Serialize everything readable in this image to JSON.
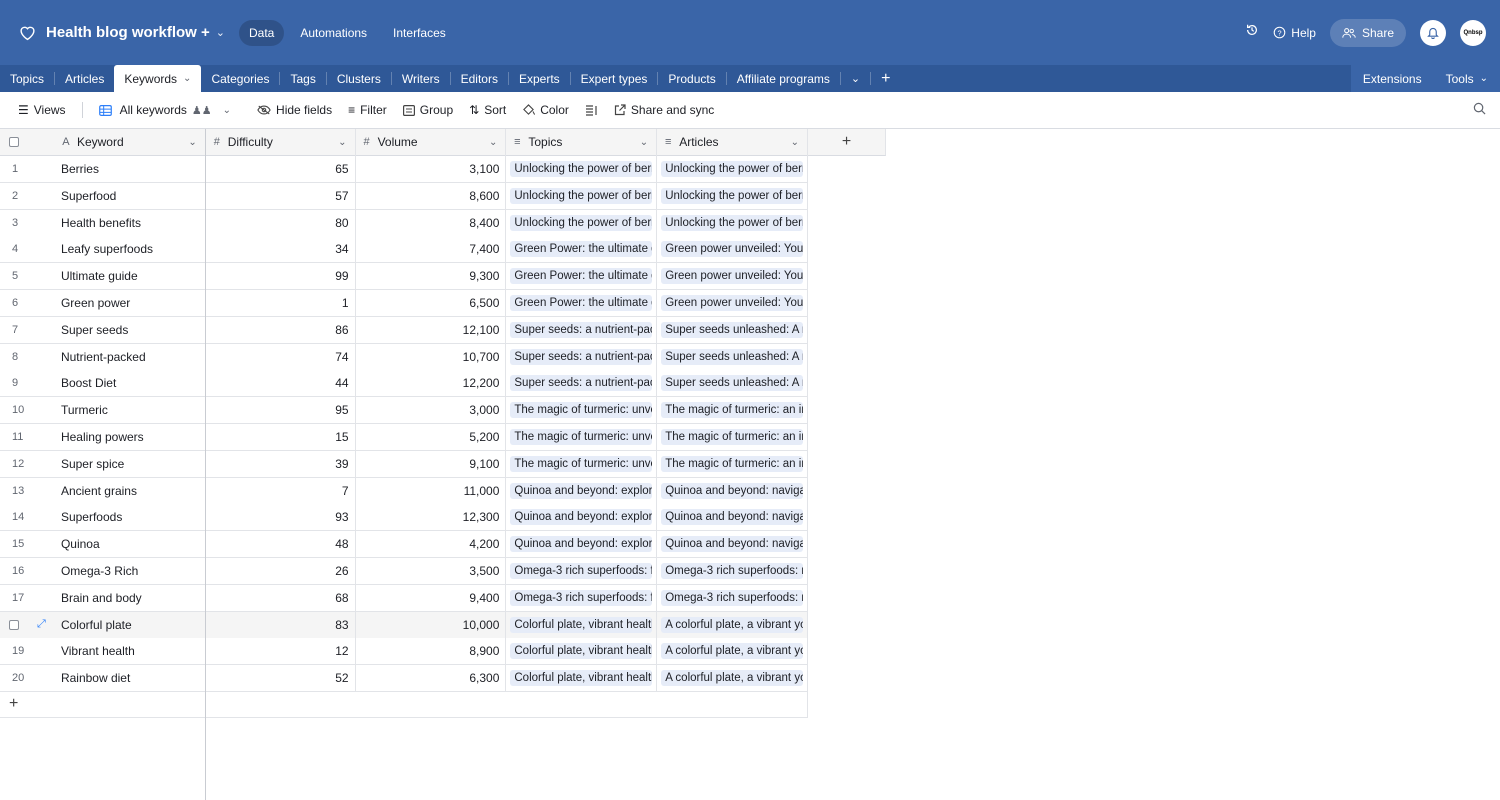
{
  "app": {
    "base_title": "Health blog workflow +",
    "nav": [
      {
        "label": "Data",
        "active": true
      },
      {
        "label": "Automations",
        "active": false
      },
      {
        "label": "Interfaces",
        "active": false
      }
    ],
    "help_label": "Help",
    "share_label": "Share",
    "avatar_text": "Qnbsp",
    "brand_color": "#3a65a8"
  },
  "tables": {
    "items": [
      "Topics",
      "Articles",
      "Keywords",
      "Categories",
      "Tags",
      "Clusters",
      "Writers",
      "Editors",
      "Experts",
      "Expert types",
      "Products",
      "Affiliate programs"
    ],
    "active": "Keywords",
    "extensions_label": "Extensions",
    "tools_label": "Tools"
  },
  "viewbar": {
    "views_label": "Views",
    "view_name": "All keywords",
    "hide_fields_label": "Hide fields",
    "filter_label": "Filter",
    "group_label": "Group",
    "sort_label": "Sort",
    "color_label": "Color",
    "share_sync_label": "Share and sync"
  },
  "columns": [
    {
      "label": "Keyword",
      "icon": "text-icon"
    },
    {
      "label": "Difficulty",
      "icon": "number-icon"
    },
    {
      "label": "Volume",
      "icon": "number-icon"
    },
    {
      "label": "Topics",
      "icon": "link-icon"
    },
    {
      "label": "Articles",
      "icon": "link-icon"
    }
  ],
  "rows": [
    {
      "n": "1",
      "keyword": "Berries",
      "difficulty": "65",
      "volume": "3,100",
      "topic": "Unlocking the power of berr",
      "article": "Unlocking the power of berr"
    },
    {
      "n": "2",
      "keyword": "Superfood",
      "difficulty": "57",
      "volume": "8,600",
      "topic": "Unlocking the power of berr",
      "article": "Unlocking the power of berr"
    },
    {
      "n": "3",
      "keyword": "Health benefits",
      "difficulty": "80",
      "volume": "8,400",
      "topic": "Unlocking the power of berr",
      "article": "Unlocking the power of berr"
    },
    {
      "n": "4",
      "keyword": "Leafy superfoods",
      "difficulty": "34",
      "volume": "7,400",
      "topic": "Green Power: the ultimate g",
      "article": "Green power unveiled: Your"
    },
    {
      "n": "5",
      "keyword": "Ultimate guide",
      "difficulty": "99",
      "volume": "9,300",
      "topic": "Green Power: the ultimate g",
      "article": "Green power unveiled: Your"
    },
    {
      "n": "6",
      "keyword": "Green power",
      "difficulty": "1",
      "volume": "6,500",
      "topic": "Green Power: the ultimate g",
      "article": "Green power unveiled: Your"
    },
    {
      "n": "7",
      "keyword": "Super seeds",
      "difficulty": "86",
      "volume": "12,100",
      "topic": "Super seeds: a nutrient-pac",
      "article": "Super seeds unleashed: A n"
    },
    {
      "n": "8",
      "keyword": "Nutrient-packed",
      "difficulty": "74",
      "volume": "10,700",
      "topic": "Super seeds: a nutrient-pac",
      "article": "Super seeds unleashed: A n"
    },
    {
      "n": "9",
      "keyword": "Boost Diet",
      "difficulty": "44",
      "volume": "12,200",
      "topic": "Super seeds: a nutrient-pac",
      "article": "Super seeds unleashed: A n"
    },
    {
      "n": "10",
      "keyword": "Turmeric",
      "difficulty": "95",
      "volume": "3,000",
      "topic": "The magic of turmeric: unve",
      "article": "The magic of turmeric: an ir"
    },
    {
      "n": "11",
      "keyword": "Healing powers",
      "difficulty": "15",
      "volume": "5,200",
      "topic": "The magic of turmeric: unve",
      "article": "The magic of turmeric: an ir"
    },
    {
      "n": "12",
      "keyword": "Super spice",
      "difficulty": "39",
      "volume": "9,100",
      "topic": "The magic of turmeric: unve",
      "article": "The magic of turmeric: an ir"
    },
    {
      "n": "13",
      "keyword": "Ancient grains",
      "difficulty": "7",
      "volume": "11,000",
      "topic": "Quinoa and beyond: explori",
      "article": "Quinoa and beyond: navigat"
    },
    {
      "n": "14",
      "keyword": "Superfoods",
      "difficulty": "93",
      "volume": "12,300",
      "topic": "Quinoa and beyond: explori",
      "article": "Quinoa and beyond: navigat"
    },
    {
      "n": "15",
      "keyword": "Quinoa",
      "difficulty": "48",
      "volume": "4,200",
      "topic": "Quinoa and beyond: explori",
      "article": "Quinoa and beyond: navigat"
    },
    {
      "n": "16",
      "keyword": "Omega-3 Rich",
      "difficulty": "26",
      "volume": "3,500",
      "topic": "Omega-3 rich superfoods: f",
      "article": "Omega-3 rich superfoods: r"
    },
    {
      "n": "17",
      "keyword": "Brain and body",
      "difficulty": "68",
      "volume": "9,400",
      "topic": "Omega-3 rich superfoods: f",
      "article": "Omega-3 rich superfoods: r"
    },
    {
      "n": "",
      "keyword": "Colorful plate",
      "difficulty": "83",
      "volume": "10,000",
      "topic": "Colorful plate, vibrant healtl",
      "article": "A colorful plate, a vibrant yo",
      "hover": true
    },
    {
      "n": "19",
      "keyword": "Vibrant health",
      "difficulty": "12",
      "volume": "8,900",
      "topic": "Colorful plate, vibrant healtl",
      "article": "A colorful plate, a vibrant yo"
    },
    {
      "n": "20",
      "keyword": "Rainbow diet",
      "difficulty": "52",
      "volume": "6,300",
      "topic": "Colorful plate, vibrant healtl",
      "article": "A colorful plate, a vibrant yo"
    }
  ]
}
